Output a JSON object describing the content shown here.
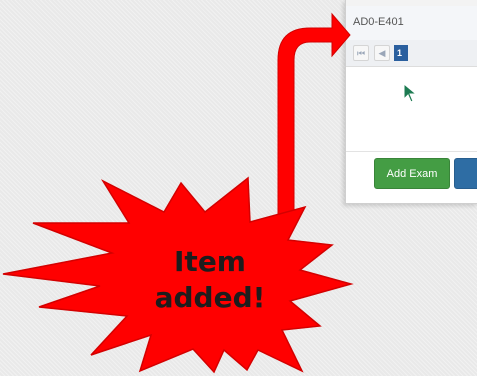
{
  "grid": {
    "row_value": "AD0-E401"
  },
  "pager": {
    "first_icon": "first-page-icon",
    "prev_icon": "prev-page-icon",
    "current_page": "1"
  },
  "buttons": {
    "add_exam_label": "Add Exam"
  },
  "callout": {
    "line1": "Item",
    "line2": "added!"
  },
  "colors": {
    "callout_red": "#ff0000",
    "add_button_green": "#449d44",
    "pager_active_blue": "#2a5f9e"
  }
}
